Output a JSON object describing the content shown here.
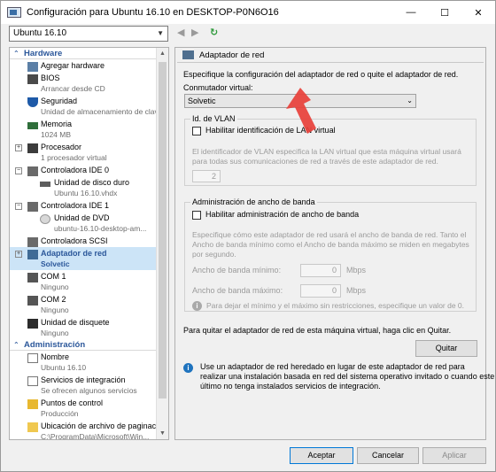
{
  "window": {
    "title": "Configuración para Ubuntu 16.10 en DESKTOP-P0N6O16",
    "minimize": "—",
    "maximize": "☐",
    "close": "✕"
  },
  "toolbar": {
    "vm_selector": "Ubuntu 16.10"
  },
  "tree": {
    "hardware_header": "Hardware",
    "admin_header": "Administración",
    "items": [
      {
        "name": "Agregar hardware",
        "sub": ""
      },
      {
        "name": "BIOS",
        "sub": "Arrancar desde CD"
      },
      {
        "name": "Seguridad",
        "sub": "Unidad de almacenamiento de claves ..."
      },
      {
        "name": "Memoria",
        "sub": "1024 MB"
      },
      {
        "name": "Procesador",
        "sub": "1 procesador virtual"
      },
      {
        "name": "Controladora IDE 0",
        "sub": ""
      },
      {
        "name": "Unidad de disco duro",
        "sub": "Ubuntu 16.10.vhdx"
      },
      {
        "name": "Controladora IDE 1",
        "sub": ""
      },
      {
        "name": "Unidad de DVD",
        "sub": "ubuntu-16.10-desktop-am..."
      },
      {
        "name": "Controladora SCSI",
        "sub": ""
      },
      {
        "name": "Adaptador de red",
        "sub": "Solvetic"
      },
      {
        "name": "COM 1",
        "sub": "Ninguno"
      },
      {
        "name": "COM 2",
        "sub": "Ninguno"
      },
      {
        "name": "Unidad de disquete",
        "sub": "Ninguno"
      },
      {
        "name": "Nombre",
        "sub": "Ubuntu 16.10"
      },
      {
        "name": "Servicios de integración",
        "sub": "Se ofrecen algunos servicios"
      },
      {
        "name": "Puntos de control",
        "sub": "Producción"
      },
      {
        "name": "Ubicación de archivo de paginac...",
        "sub": "C:\\ProgramData\\Microsoft\\Win..."
      }
    ]
  },
  "panel": {
    "title": "Adaptador de red",
    "intro": "Especifique la configuración del adaptador de red o quite el adaptador de red.",
    "switch_label": "Conmutador virtual:",
    "switch_value": "Solvetic",
    "vlan_group": "Id. de VLAN",
    "vlan_check": "Habilitar identificación de LAN virtual",
    "vlan_desc1": "El identificador de VLAN especifica la LAN virtual que esta máquina virtual usará",
    "vlan_desc2": "para todas sus comunicaciones de red a través de este adaptador de red.",
    "vlan_value": "2",
    "bw_group": "Administración de ancho de banda",
    "bw_check": "Habilitar administración de ancho de banda",
    "bw_desc1": "Especifique cómo este adaptador de red usará el ancho de banda de red. Tanto el",
    "bw_desc2": "Ancho de banda mínimo como el Ancho de banda máximo se miden en megabytes",
    "bw_desc3": "por segundo.",
    "bw_min_label": "Ancho de banda mínimo:",
    "bw_min_value": "0",
    "bw_max_label": "Ancho de banda máximo:",
    "bw_max_value": "0",
    "unit": "Mbps",
    "bw_hint": "Para dejar el mínimo y el máximo sin restricciones, especifique un valor de 0.",
    "remove_desc": "Para quitar el adaptador de red de esta máquina virtual, haga clic en Quitar.",
    "remove_btn": "Quitar",
    "legacy1": "Use un adaptador de red heredado en lugar de este adaptador de red para",
    "legacy2": "realizar una instalación basada en red del sistema operativo invitado o cuando este",
    "legacy3": "último no tenga instalados servicios de integración."
  },
  "buttons": {
    "ok": "Aceptar",
    "cancel": "Cancelar",
    "apply": "Aplicar"
  },
  "colors": {
    "accent": "#2b579a",
    "selection": "#cce4f7",
    "info": "#1e73be",
    "arrow": "#e8403a"
  }
}
